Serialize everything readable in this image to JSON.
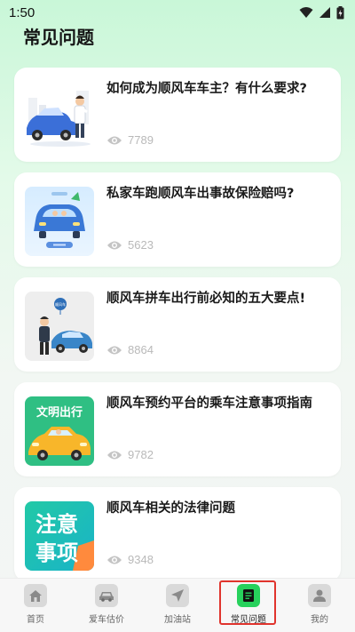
{
  "status": {
    "time": "1:50"
  },
  "page": {
    "title": "常见问题"
  },
  "articles": [
    {
      "title": "如何成为顺风车车主？有什么要求?",
      "views": "7789"
    },
    {
      "title": "私家车跑顺风车出事故保险赔吗?",
      "views": "5623"
    },
    {
      "title": "顺风车拼车出行前必知的五大要点!",
      "views": "8864",
      "thumb_badge": "顺风车"
    },
    {
      "title": "顺风车预约平台的乘车注意事项指南",
      "views": "9782",
      "thumb_text": "文明出行"
    },
    {
      "title": "顺风车相关的法律问题",
      "views": "9348",
      "thumb_text_1": "注意",
      "thumb_text_2": "事项"
    }
  ],
  "tabs": [
    {
      "label": "首页",
      "icon": "home-icon"
    },
    {
      "label": "爱车估价",
      "icon": "car-icon"
    },
    {
      "label": "加油站",
      "icon": "navigation-icon"
    },
    {
      "label": "常见问题",
      "icon": "document-icon",
      "active": true
    },
    {
      "label": "我的",
      "icon": "person-icon"
    }
  ],
  "colors": {
    "accent": "#27d15c",
    "highlight_box": "#e0342d"
  }
}
